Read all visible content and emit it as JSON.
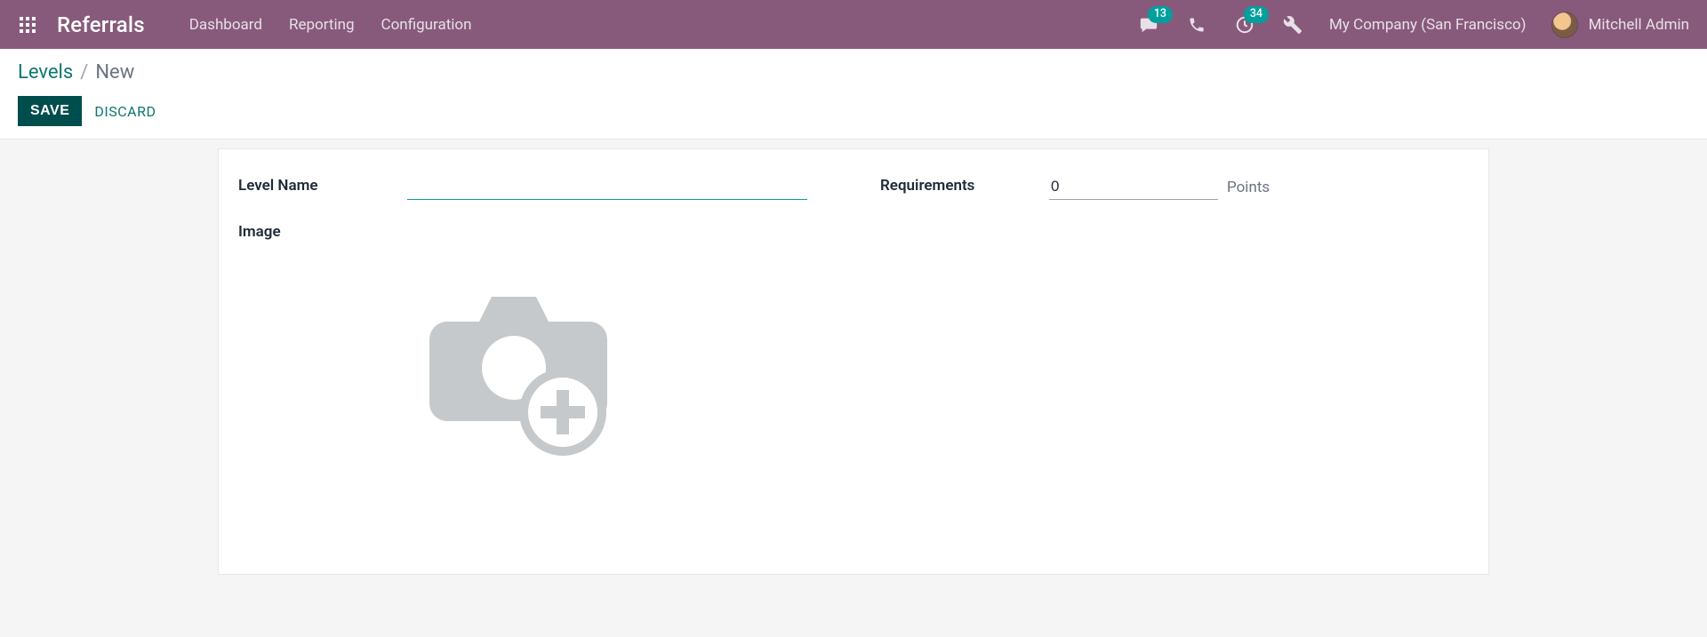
{
  "nav": {
    "brand": "Referrals",
    "items": [
      "Dashboard",
      "Reporting",
      "Configuration"
    ],
    "messages_badge": "13",
    "activities_badge": "34",
    "company": "My Company (San Francisco)",
    "username": "Mitchell Admin"
  },
  "breadcrumb": {
    "parent": "Levels",
    "sep": "/",
    "current": "New"
  },
  "actions": {
    "save": "SAVE",
    "discard": "DISCARD"
  },
  "form": {
    "level_name_label": "Level Name",
    "level_name_value": "",
    "requirements_label": "Requirements",
    "requirements_value": "0",
    "requirements_unit": "Points",
    "image_label": "Image"
  }
}
